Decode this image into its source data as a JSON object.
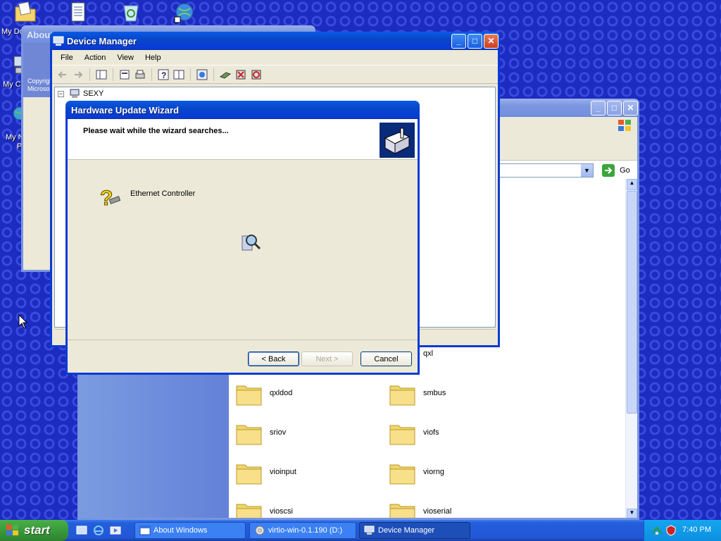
{
  "desktop": {
    "icons": [
      {
        "name": "my-documents",
        "label": "My Do"
      },
      {
        "name": "my-computer",
        "label": "My C"
      },
      {
        "name": "my-network-places",
        "label": "My N\nPl"
      }
    ]
  },
  "about_window": {
    "title": "About",
    "copyright_line1": "Copyrigh",
    "copyright_line2": "Microso"
  },
  "device_manager": {
    "title": "Device Manager",
    "menu": [
      "File",
      "Action",
      "View",
      "Help"
    ],
    "tree_root": "SEXY"
  },
  "wizard": {
    "title": "Hardware Update Wizard",
    "heading": "Please wait while the wizard searches...",
    "device_name": "Ethernet Controller",
    "buttons": {
      "back": "< Back",
      "next": "Next >",
      "cancel": "Cancel"
    }
  },
  "explorer": {
    "go_label": "Go",
    "folders_col1": [
      "qxldod",
      "sriov",
      "vioinput",
      "vioscsi"
    ],
    "folders_col2": [
      "qxl",
      "smbus",
      "viofs",
      "viorng",
      "vioserial"
    ]
  },
  "taskbar": {
    "start_label": "start",
    "tasks": [
      {
        "label": "About Windows",
        "active": false
      },
      {
        "label": "virtio-win-0.1.190 (D:)",
        "active": false
      },
      {
        "label": "Device Manager",
        "active": true
      }
    ],
    "clock": "7:40 PM"
  },
  "colors": {
    "desktop": "#1c2bc0",
    "title_active": "#0a3bd6",
    "window_face": "#ece9d8",
    "start_green": "#3a9a3a",
    "explorer_sidebar": "#7a9be0"
  }
}
